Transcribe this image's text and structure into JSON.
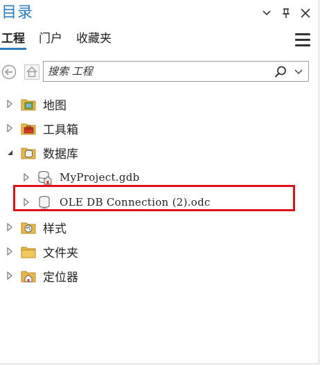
{
  "pane": {
    "title": "目录"
  },
  "tabs": [
    {
      "label": "工程",
      "active": true
    },
    {
      "label": "门户",
      "active": false
    },
    {
      "label": "收藏夹",
      "active": false
    }
  ],
  "search": {
    "placeholder": "搜索 工程"
  },
  "tree": {
    "items": [
      {
        "label": "地图",
        "icon": "map-folder-icon",
        "expanded": false
      },
      {
        "label": "工具箱",
        "icon": "toolbox-folder-icon",
        "expanded": false
      },
      {
        "label": "数据库",
        "icon": "database-folder-icon",
        "expanded": true
      },
      {
        "label": "MyProject.gdb",
        "icon": "geodatabase-icon",
        "expanded": false
      },
      {
        "label": "OLE DB Connection (2).odc",
        "icon": "database-connection-icon",
        "expanded": false
      },
      {
        "label": "样式",
        "icon": "style-folder-icon",
        "expanded": false
      },
      {
        "label": "文件夹",
        "icon": "folder-icon",
        "expanded": false
      },
      {
        "label": "定位器",
        "icon": "locator-folder-icon",
        "expanded": false
      }
    ]
  },
  "colors": {
    "accent": "#2a7bc0",
    "highlight": "#e0101a",
    "folder": "#e8b84a"
  }
}
